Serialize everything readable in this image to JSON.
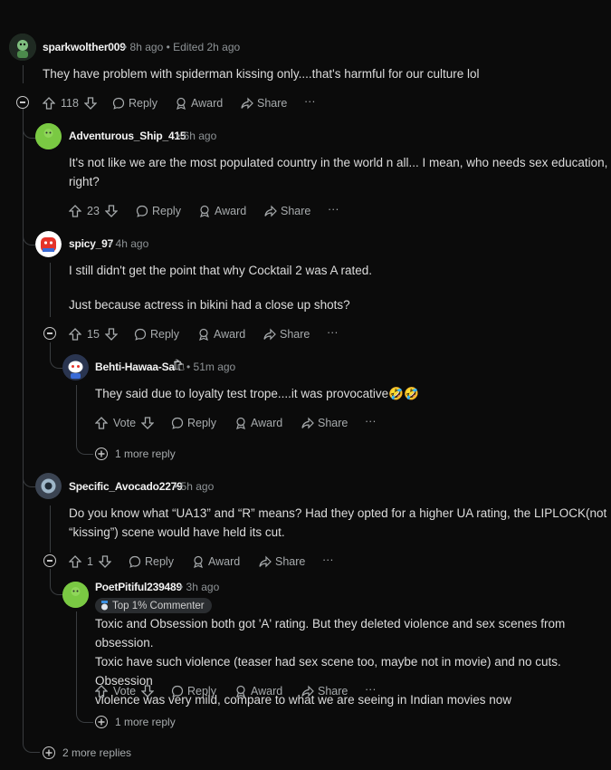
{
  "comments": [
    {
      "username": "sparkwolther009",
      "meta": "• 8h ago • Edited 2h ago",
      "body": [
        "They have problem with spiderman kissing only....that's harmful for our culture lol"
      ],
      "votes": "118",
      "actions": {
        "reply": "Reply",
        "award": "Award",
        "share": "Share",
        "more": "···"
      }
    },
    {
      "username": "Adventurous_Ship_415",
      "meta": "• 6h ago",
      "body": [
        "It's not like we are the most populated country in the world n all... I mean, who needs sex education,",
        "right?"
      ],
      "votes": "23",
      "actions": {
        "reply": "Reply",
        "award": "Award",
        "share": "Share",
        "more": "···"
      }
    },
    {
      "username": "spicy_97",
      "meta": "• 4h ago",
      "body": [
        "I still didn't get the point that why Cocktail 2 was A rated.",
        "Just because actress in bikini had a close up shots?"
      ],
      "votes": "15",
      "actions": {
        "reply": "Reply",
        "award": "Award",
        "share": "Share",
        "more": "···"
      }
    },
    {
      "username": "Behti-Hawaa-Sa",
      "meta": "• 51m ago",
      "body": [
        "They said due to loyalty test trope....it was provocative🤣🤣"
      ],
      "votes": "Vote",
      "actions": {
        "reply": "Reply",
        "award": "Award",
        "share": "Share",
        "more": "···"
      },
      "more_reply": "1 more reply"
    },
    {
      "username": "Specific_Avocado2279",
      "meta": "• 5h ago",
      "body": [
        "Do you know what “UA13” and “R” means? Had they opted for a higher UA rating, the LIPLOCK(not",
        "“kissing”) scene would have held its cut."
      ],
      "votes": "1",
      "actions": {
        "reply": "Reply",
        "award": "Award",
        "share": "Share",
        "more": "···"
      }
    },
    {
      "username": "PoetPitiful239489",
      "meta": "• 3h ago",
      "badge": "Top 1% Commenter",
      "body": [
        "Toxic and Obsession both got 'A' rating. But they deleted violence and sex scenes from obsession.",
        "Toxic have such violence (teaser had sex scene too, maybe not in movie) and no cuts. Obsession",
        "violence was very mild, compare to what we are seeing in Indian movies now"
      ],
      "votes": "Vote",
      "actions": {
        "reply": "Reply",
        "award": "Award",
        "share": "Share",
        "more": "···"
      },
      "more_reply": "1 more reply"
    }
  ],
  "more_replies": "2 more replies",
  "colors": {
    "background": "#0b0b0b",
    "thread_line": "#3a3d40",
    "text": "#d7dadc"
  }
}
